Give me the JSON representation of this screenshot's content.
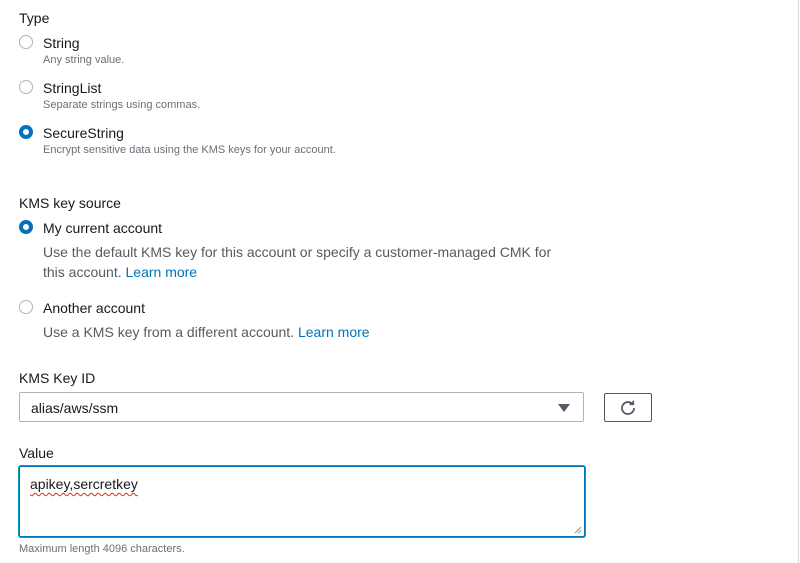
{
  "type_section": {
    "label": "Type",
    "options": [
      {
        "label": "String",
        "description": "Any string value.",
        "selected": false
      },
      {
        "label": "StringList",
        "description": "Separate strings using commas.",
        "selected": false
      },
      {
        "label": "SecureString",
        "description": "Encrypt sensitive data using the KMS keys for your account.",
        "selected": true
      }
    ]
  },
  "kms_source": {
    "label": "KMS key source",
    "options": [
      {
        "label": "My current account",
        "description": "Use the default KMS key for this account or specify a customer-managed CMK for",
        "description_line2": "this account.",
        "link": "Learn more",
        "selected": true
      },
      {
        "label": "Another account",
        "description": "Use a KMS key from a different account.",
        "link": "Learn more",
        "selected": false
      }
    ]
  },
  "kms_key_id": {
    "label": "KMS Key ID",
    "value": "alias/aws/ssm"
  },
  "value_field": {
    "label": "Value",
    "value": "apikey,sercretkey",
    "hint": "Maximum length 4096 characters."
  },
  "colors": {
    "accent": "#0073bb",
    "text": "#16191f",
    "muted": "#687078",
    "border": "#aab7b8"
  },
  "icons": {
    "refresh": "refresh-icon",
    "dropdown": "caret-down-icon"
  }
}
